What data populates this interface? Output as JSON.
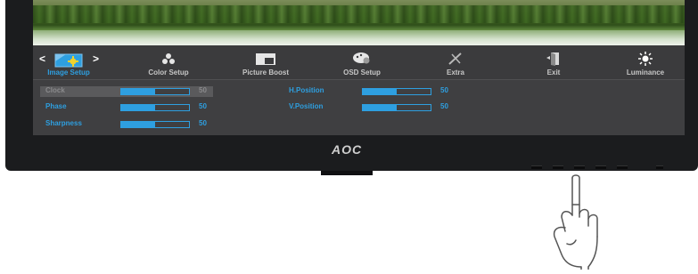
{
  "monitor": {
    "brand": "AOC"
  },
  "menu": {
    "items": [
      {
        "label": "Image Setup",
        "icon": "image-setup-icon",
        "active": true
      },
      {
        "label": "Color Setup",
        "icon": "color-setup-icon"
      },
      {
        "label": "Picture Boost",
        "icon": "picture-boost-icon"
      },
      {
        "label": "OSD Setup",
        "icon": "osd-setup-icon"
      },
      {
        "label": "Extra",
        "icon": "extra-icon"
      },
      {
        "label": "Exit",
        "icon": "exit-icon"
      },
      {
        "label": "Luminance",
        "icon": "luminance-icon"
      }
    ]
  },
  "settings": {
    "left": [
      {
        "label": "Clock",
        "value": "50",
        "level": 0.5
      },
      {
        "label": "Phase",
        "value": "50",
        "level": 0.5
      },
      {
        "label": "Sharpness",
        "value": "50",
        "level": 0.5
      }
    ],
    "right": [
      {
        "label": "H.Position",
        "value": "50",
        "level": 0.5
      },
      {
        "label": "V.Position",
        "value": "50",
        "level": 0.5
      }
    ]
  },
  "colors": {
    "accent": "#2e9fe0",
    "panel": "#3f3f41",
    "bezel": "#1b1c1e"
  }
}
